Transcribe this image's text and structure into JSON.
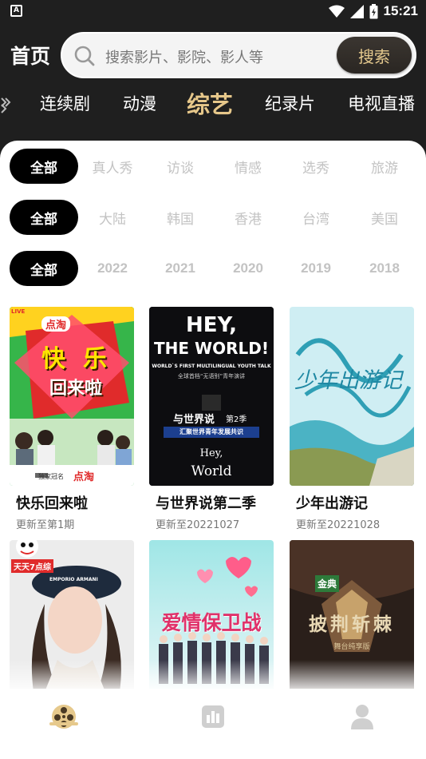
{
  "status": {
    "app_badge": "A",
    "time": "15:21"
  },
  "header": {
    "title": "首页",
    "search_placeholder": "搜索影片、影院、影人等",
    "search_button": "搜索"
  },
  "categories": [
    "连续剧",
    "动漫",
    "综艺",
    "纪录片",
    "电视直播"
  ],
  "active_category": "综艺",
  "filters": {
    "type": [
      "全部",
      "真人秀",
      "访谈",
      "情感",
      "选秀",
      "旅游"
    ],
    "region": [
      "全部",
      "大陆",
      "韩国",
      "香港",
      "台湾",
      "美国"
    ],
    "year": [
      "全部",
      "2022",
      "2021",
      "2020",
      "2019",
      "2018"
    ]
  },
  "cards": [
    {
      "title": "快乐回来啦",
      "subtitle": "更新至第1期",
      "poster": {
        "live_tag": "LIVE",
        "brand": "点淘",
        "title_line1": "快",
        "title_line2": "乐",
        "title_line3": "回来啦",
        "footer": "独家冠名",
        "footer_brand": "点淘"
      }
    },
    {
      "title": "与世界说第二季",
      "subtitle": "更新至20221027",
      "poster": {
        "line1": "HEY,",
        "line2": "THE WORLD!",
        "line3": "WORLD`S FIRST MULTILINGUAL YOUTH TALK",
        "line4": "全球首档“无语别”青年演讲",
        "line5": "与世界说",
        "line5b": "第2季",
        "line6": "汇聚世界青年发展共识",
        "line7": "Hey,",
        "line8": "World"
      }
    },
    {
      "title": "少年出游记",
      "subtitle": "更新至20221028",
      "poster": {
        "calligraphy": "少年出游记"
      }
    },
    {
      "title": "",
      "subtitle": "",
      "poster": {
        "tag": "天天7点综",
        "brand": "EMPORIO ARMANI"
      }
    },
    {
      "title": "",
      "subtitle": "",
      "poster": {
        "title": "爱情保卫战"
      }
    },
    {
      "title": "",
      "subtitle": "",
      "poster": {
        "badge": "金典",
        "title": "披荆斩棘",
        "sub": "舞台纯享版"
      }
    }
  ],
  "colors": {
    "accent": "#e6c78a",
    "dark": "#1f1f1f"
  },
  "nav": [
    {
      "icon": "film-reel-icon",
      "active": true
    },
    {
      "icon": "chart-icon",
      "active": false
    },
    {
      "icon": "profile-icon",
      "active": false
    }
  ]
}
